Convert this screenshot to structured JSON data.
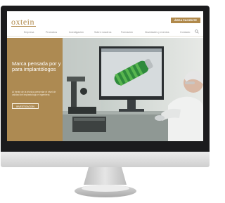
{
  "site": {
    "logo": "oxtein",
    "cta_label": "ÁREA PACIENTE"
  },
  "nav": {
    "items": [
      "Empresa",
      "Productos",
      "Investigación",
      "Sobre nosotros",
      "Formación",
      "Novedades y eventos",
      "Contacto"
    ]
  },
  "hero": {
    "title": "Marca pensada por y para implantólogos",
    "text": "Al frente de la técnica presentar el nivel de calidad del implantologo e ingeniería",
    "button_label": "INVESTIGACIÓN"
  },
  "colors": {
    "brand": "#b0894b",
    "hero_panel": "#ad8a52",
    "bezel": "#1b1b1d"
  }
}
